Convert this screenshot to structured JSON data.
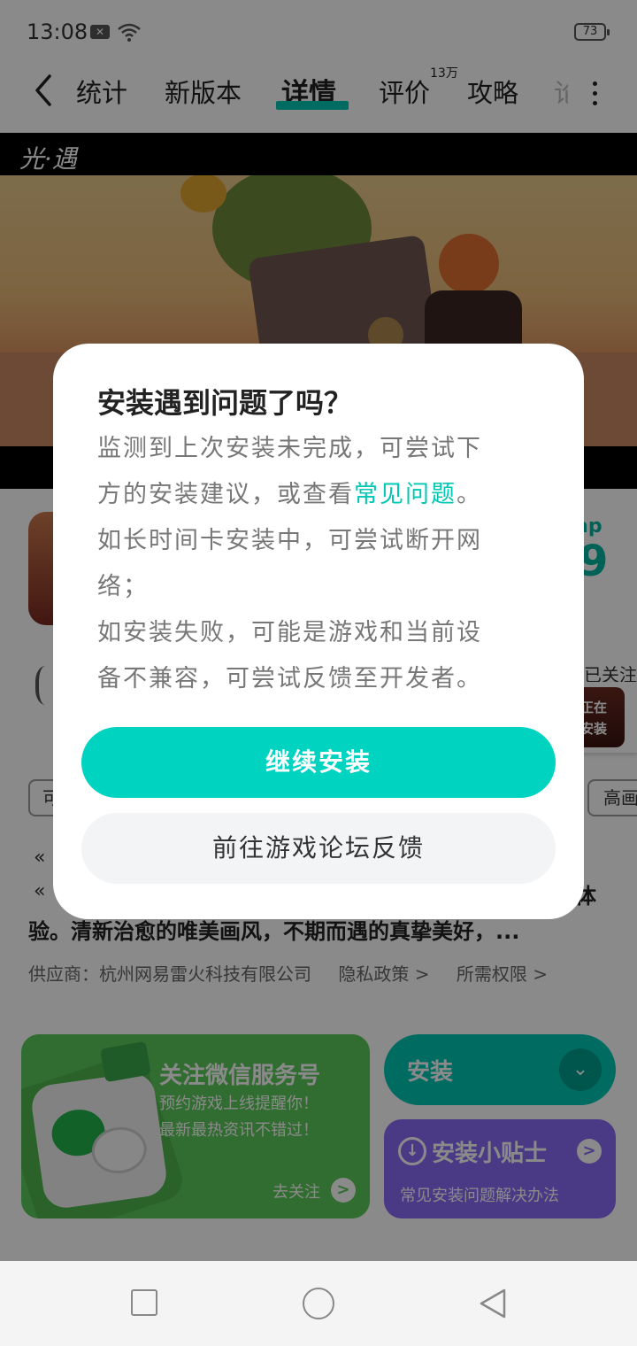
{
  "status_bar": {
    "time": "13:08",
    "battery": "73",
    "notification_icon": "x-icon",
    "wifi_icon": "wifi-icon"
  },
  "nav": {
    "tabs": [
      {
        "label": "统计"
      },
      {
        "label": "新版本"
      },
      {
        "label": "详情"
      },
      {
        "label": "评价"
      },
      {
        "label": "攻略"
      },
      {
        "label": "论"
      }
    ],
    "reviews_badge": "13万",
    "active_tab": "详情"
  },
  "banner": {
    "logo_text": "光·遇"
  },
  "app": {
    "tap_label": "ap",
    "tap_score": "9",
    "follow_label": "已关注"
  },
  "tags": {
    "left": "可",
    "right": "高画"
  },
  "description": {
    "line1": "«",
    "line2": "«",
    "line2_end": "体",
    "line3": "验。清新治愈的唯美画风，不期而遇的真挚美好，...",
    "supplier": "供应商：杭州网易雷火科技有限公司",
    "privacy": "隐私政策 >",
    "permissions": "所需权限 >"
  },
  "wechat_card": {
    "title": "关注微信服务号",
    "sub1": "预约游戏上线提醒你！",
    "sub2": "最新最热资讯不错过！",
    "go_label": "去关注",
    "go_arrow": ">"
  },
  "install_button": {
    "label": "安装",
    "chevron": "⌄"
  },
  "tips_card": {
    "title": "安装小贴士",
    "subtitle": "常见安装问题解决办法",
    "arrow": ">",
    "icon": "↓"
  },
  "floating_widget": {
    "line1": "正在",
    "line2": "安装"
  },
  "dialog": {
    "title": "安装遇到问题了吗？",
    "line1": "监测到上次安装未完成，可尝试下",
    "line2_prefix": "方的安装建议，或查看",
    "line2_link": "常见问题",
    "line2_suffix": "。",
    "line3": "如长时间卡安装中，可尝试断开网",
    "line4": "络；",
    "line5": "如安装失败，可能是游戏和当前设",
    "line6": "备不兼容，可尝试反馈至开发者。",
    "primary_button": "继续安装",
    "secondary_button": "前往游戏论坛反馈"
  },
  "colors": {
    "accent": "#00c8b4",
    "tips_purple": "#8a6cf5",
    "wechat_green": "#5cc75c",
    "dim_overlay": "rgba(0,0,0,0.46)"
  }
}
